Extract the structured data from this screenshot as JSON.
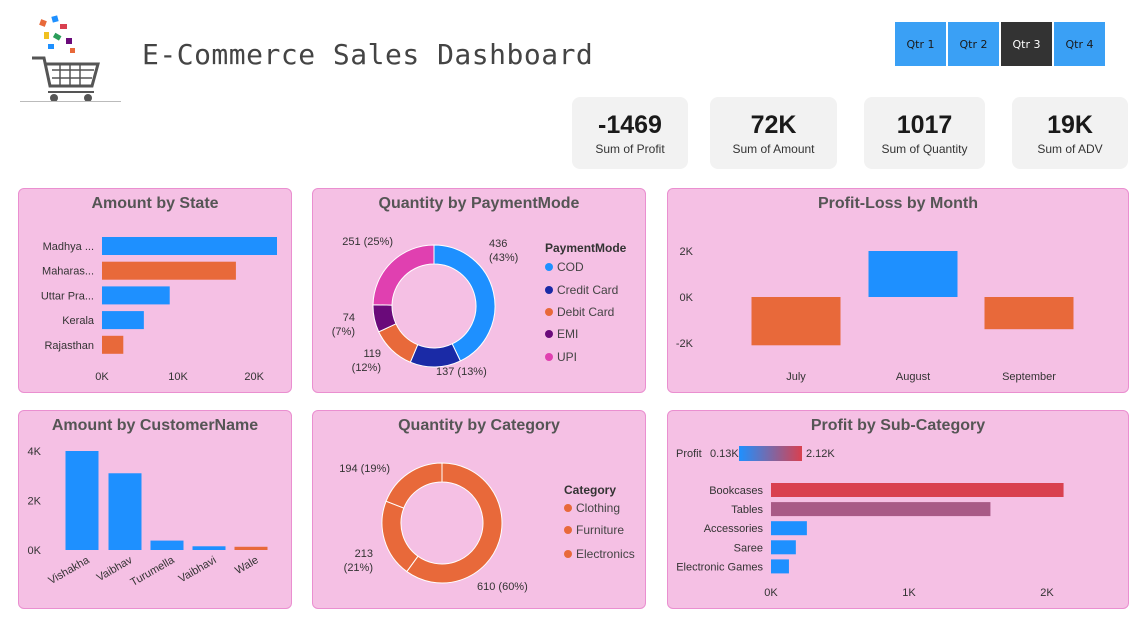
{
  "header": {
    "title": "E-Commerce Sales Dashboard"
  },
  "slicer": {
    "items": [
      "Qtr 1",
      "Qtr 2",
      "Qtr 3",
      "Qtr 4"
    ],
    "selected": "Qtr 3"
  },
  "kpis": [
    {
      "value": "-1469",
      "label": "Sum of Profit"
    },
    {
      "value": "72K",
      "label": "Sum of Amount"
    },
    {
      "value": "1017",
      "label": "Sum of Quantity"
    },
    {
      "value": "19K",
      "label": "Sum of ADV"
    }
  ],
  "colors": {
    "blue": "#1e90ff",
    "orange": "#e8693a",
    "navy": "#1a2aa6",
    "purple": "#6a0a7a",
    "magenta": "#e040b0",
    "panel": "#f5c0e4",
    "crimson": "#d9404f",
    "mauve": "#a85a86"
  },
  "chart_data": [
    {
      "id": "amount-by-state",
      "type": "bar",
      "orientation": "horizontal",
      "title": "Amount by State",
      "categories": [
        "Madhya ...",
        "Maharas...",
        "Uttar Pra...",
        "Kerala",
        "Rajasthan"
      ],
      "values": [
        23000,
        17600,
        8900,
        5500,
        2800
      ],
      "colors": [
        "#1e90ff",
        "#e8693a",
        "#1e90ff",
        "#1e90ff",
        "#e8693a"
      ],
      "xticks": [
        "0K",
        "10K",
        "20K"
      ],
      "xlim": [
        0,
        23000
      ]
    },
    {
      "id": "qty-by-paymentmode",
      "type": "pie",
      "donut": true,
      "title": "Quantity by PaymentMode",
      "legend_title": "PaymentMode",
      "labels": [
        "COD",
        "Credit Card",
        "Debit Card",
        "EMI",
        "UPI"
      ],
      "values": [
        436,
        137,
        119,
        74,
        251
      ],
      "percent_labels": [
        "436 (43%)",
        "137 (13%)",
        "119 (12%)",
        "74 (7%)",
        "251 (25%)"
      ],
      "colors": [
        "#1e90ff",
        "#1a2aa6",
        "#e8693a",
        "#6a0a7a",
        "#e040b0"
      ]
    },
    {
      "id": "profit-loss-by-month",
      "type": "bar",
      "title": "Profit-Loss by Month",
      "categories": [
        "July",
        "August",
        "September"
      ],
      "values": [
        -2100,
        2000,
        -1400
      ],
      "colors": [
        "#e8693a",
        "#1e90ff",
        "#e8693a"
      ],
      "yticks": [
        "2K",
        "0K",
        "-2K"
      ],
      "ylim": [
        -2500,
        2500
      ]
    },
    {
      "id": "amount-by-customer",
      "type": "bar",
      "title": "Amount by CustomerName",
      "categories": [
        "Vishakha",
        "Vaibhav",
        "Turumella",
        "Vaibhavi",
        "Wale"
      ],
      "values": [
        4000,
        3100,
        380,
        150,
        130
      ],
      "colors": [
        "#1e90ff",
        "#1e90ff",
        "#1e90ff",
        "#1e90ff",
        "#e8693a"
      ],
      "yticks": [
        "4K",
        "2K",
        "0K"
      ],
      "ylim": [
        0,
        4200
      ]
    },
    {
      "id": "qty-by-category",
      "type": "pie",
      "donut": true,
      "title": "Quantity by Category",
      "legend_title": "Category",
      "labels": [
        "Furniture",
        "Clothing",
        "Electronics"
      ],
      "values": [
        610,
        213,
        194
      ],
      "percent_labels": [
        "610 (60%)",
        "213 (21%)",
        "194 (19%)"
      ],
      "legend": [
        "Clothing",
        "Furniture",
        "Electronics"
      ],
      "colors": [
        "#e8693a",
        "#e8693a",
        "#e8693a"
      ]
    },
    {
      "id": "profit-by-subcategory",
      "type": "bar",
      "orientation": "horizontal",
      "title": "Profit by Sub-Category",
      "gradient_legend": {
        "label": "Profit",
        "min": "0.13K",
        "max": "2.12K"
      },
      "categories": [
        "Bookcases",
        "Tables",
        "Accessories",
        "Saree",
        "Electronic Games"
      ],
      "values": [
        2120,
        1590,
        260,
        180,
        130
      ],
      "colors": [
        "#d9404f",
        "#a85a86",
        "#1e90ff",
        "#1e90ff",
        "#1e90ff"
      ],
      "xticks": [
        "0K",
        "1K",
        "2K"
      ],
      "xlim": [
        0,
        2500
      ]
    }
  ]
}
